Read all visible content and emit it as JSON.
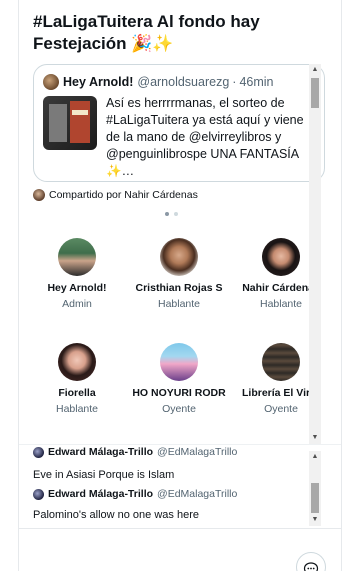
{
  "space": {
    "title": "#LaLigaTuitera Al fondo hay Festejación 🎉✨"
  },
  "pinned_tweet": {
    "author_name": "Hey Arnold!",
    "author_handle": "@arnoldsuarezg",
    "separator": "·",
    "time": "46min",
    "text": "Así es herrrrmanas, el sorteo de #LaLigaTuitera ya está aquí y viene de la mano de @elvirreylibros y @penguinlibrospe UNA FANTASÍA ✨…",
    "shared_by": "Compartido por Nahir Cárdenas"
  },
  "participants": [
    {
      "name": "Hey Arnold!",
      "role": "Admin"
    },
    {
      "name": "Cristhian Rojas S",
      "role": "Hablante"
    },
    {
      "name": "Nahir Cárdenas",
      "role": "Hablante"
    },
    {
      "name": "Fiorella",
      "role": "Hablante"
    },
    {
      "name": "HO NOYURI RODR",
      "role": "Oyente"
    },
    {
      "name": "Librería El Virre",
      "role": "Oyente"
    }
  ],
  "comments": [
    {
      "name": "Edward Málaga-Trillo",
      "handle": "@EdMalagaTrillo",
      "message": "Eve in Asiasi Porque is Islam"
    },
    {
      "name": "Edward Málaga-Trillo",
      "handle": "@EdMalagaTrillo",
      "message": "Palomino's allow no one was here"
    }
  ],
  "icons": {
    "dm": "message-icon",
    "scroll_up": "scroll-up-arrow",
    "scroll_down": "scroll-down-arrow"
  },
  "colors": {
    "text": "#0f1419",
    "secondary": "#536471",
    "border": "#cfd9de",
    "verified": "#1d9bf0"
  }
}
